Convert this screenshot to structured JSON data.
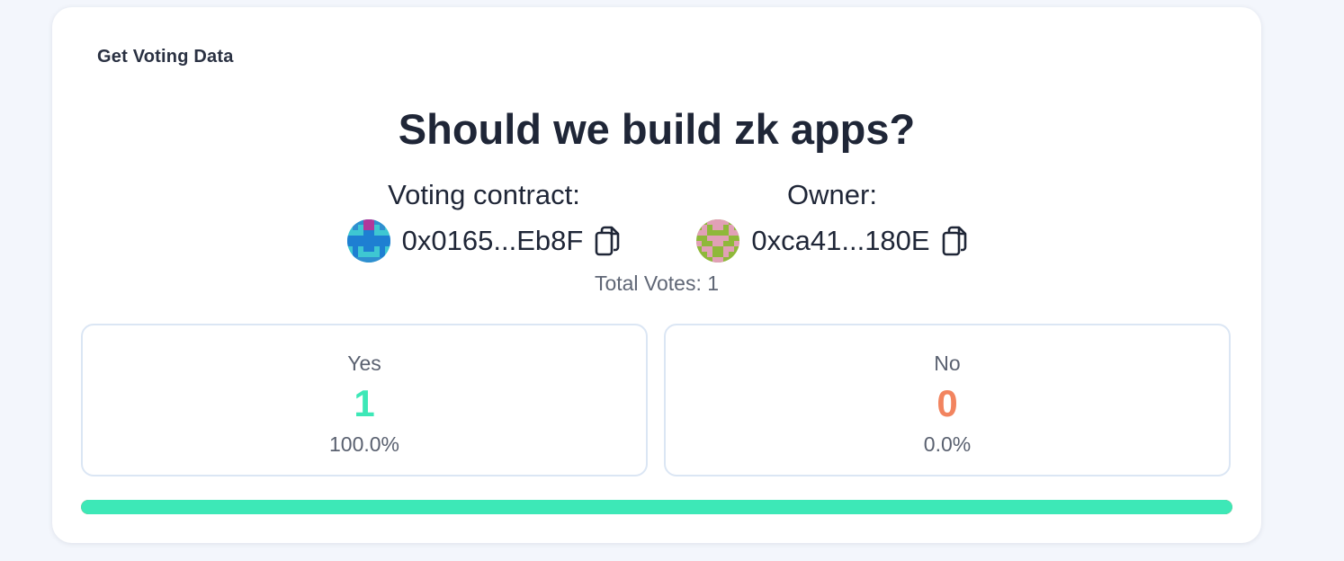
{
  "card": {
    "label": "Get Voting Data"
  },
  "poll": {
    "question": "Should we build zk apps?",
    "contract": {
      "title": "Voting contract:",
      "address": "0x0165...Eb8F",
      "avatar_icon": "identicon-icon",
      "copy_icon": "copy-icon"
    },
    "owner": {
      "title": "Owner:",
      "address": "0xca41...180E",
      "avatar_icon": "identicon-icon",
      "copy_icon": "copy-icon"
    },
    "total_votes": "Total Votes: 1"
  },
  "options": {
    "yes": {
      "label": "Yes",
      "count": "1",
      "percent": "100.0%",
      "color": "#3de8b7"
    },
    "no": {
      "label": "No",
      "count": "0",
      "percent": "0.0%",
      "color": "#f2845f"
    }
  },
  "progress": {
    "yes_fraction": 1.0,
    "yes_color": "#3de8b7",
    "no_color": "#f06a43"
  }
}
